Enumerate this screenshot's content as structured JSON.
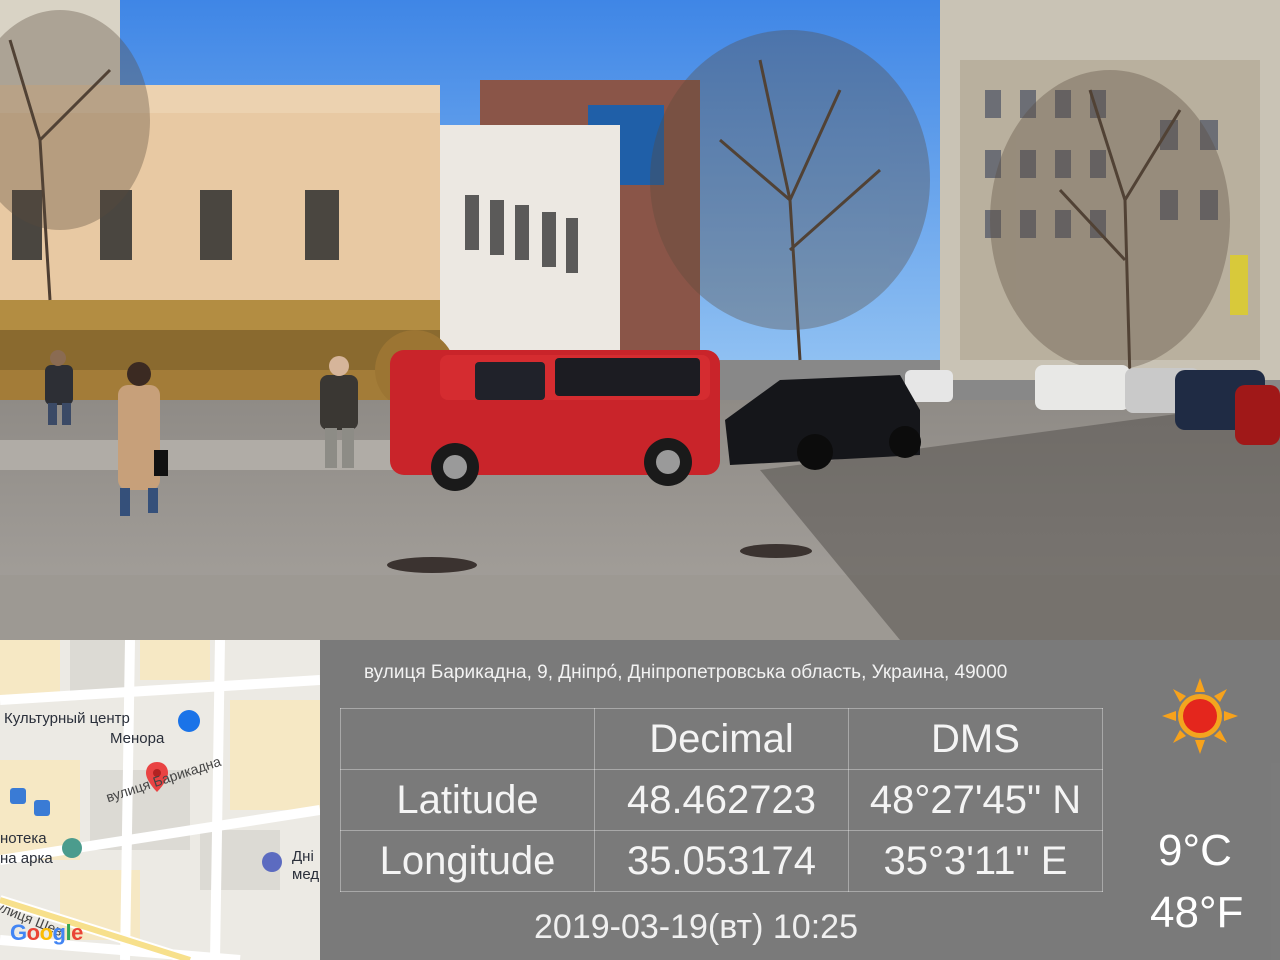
{
  "map": {
    "labels": {
      "culture_center_line1": "Культурный центр",
      "culture_center_line2": "Менора",
      "street": "вулиця Барикадна",
      "library_partial": "нотека",
      "arch_partial": "на арка",
      "dn_partial_1": "Дні",
      "dn_partial_2": "мед",
      "shev_partial": "улиця Шев"
    },
    "logo_letters": [
      "G",
      "o",
      "o",
      "g",
      "l",
      "e"
    ]
  },
  "info": {
    "address": "вулиця Барикадна, 9, Дніпро́, Дніпропетровська область, Украина, 49000",
    "table": {
      "headers": [
        "",
        "Decimal",
        "DMS"
      ],
      "rows": [
        [
          "Latitude",
          "48.462723",
          "48°27'45\" N"
        ],
        [
          "Longitude",
          "35.053174",
          "35°3'11\" E"
        ]
      ]
    },
    "datetime": "2019-03-19(вт)   10:25",
    "temp_c": "9°C",
    "temp_f": "48°F",
    "weather_icon": "sun-icon"
  }
}
